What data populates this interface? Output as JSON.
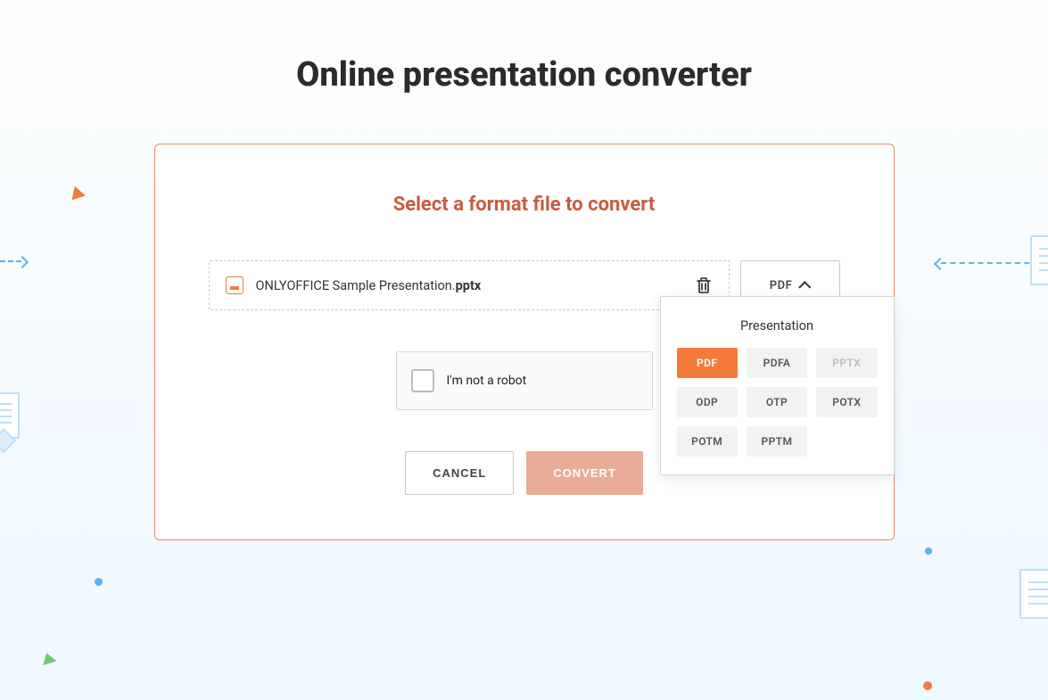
{
  "page_title": "Online presentation converter",
  "card": {
    "title": "Select a format file to convert",
    "file_name_base": "ONLYOFFICE Sample Presentation.",
    "file_name_ext": "pptx",
    "selected_format": "PDF"
  },
  "captcha": {
    "label": "I'm not a robot"
  },
  "buttons": {
    "cancel": "CANCEL",
    "convert": "CONVERT"
  },
  "dropdown": {
    "group_label": "Presentation",
    "options": [
      {
        "label": "PDF",
        "state": "active"
      },
      {
        "label": "PDFA",
        "state": "normal"
      },
      {
        "label": "PPTX",
        "state": "disabled"
      },
      {
        "label": "ODP",
        "state": "normal"
      },
      {
        "label": "OTP",
        "state": "normal"
      },
      {
        "label": "POTX",
        "state": "normal"
      },
      {
        "label": "POTM",
        "state": "normal"
      },
      {
        "label": "PPTM",
        "state": "normal"
      }
    ]
  }
}
